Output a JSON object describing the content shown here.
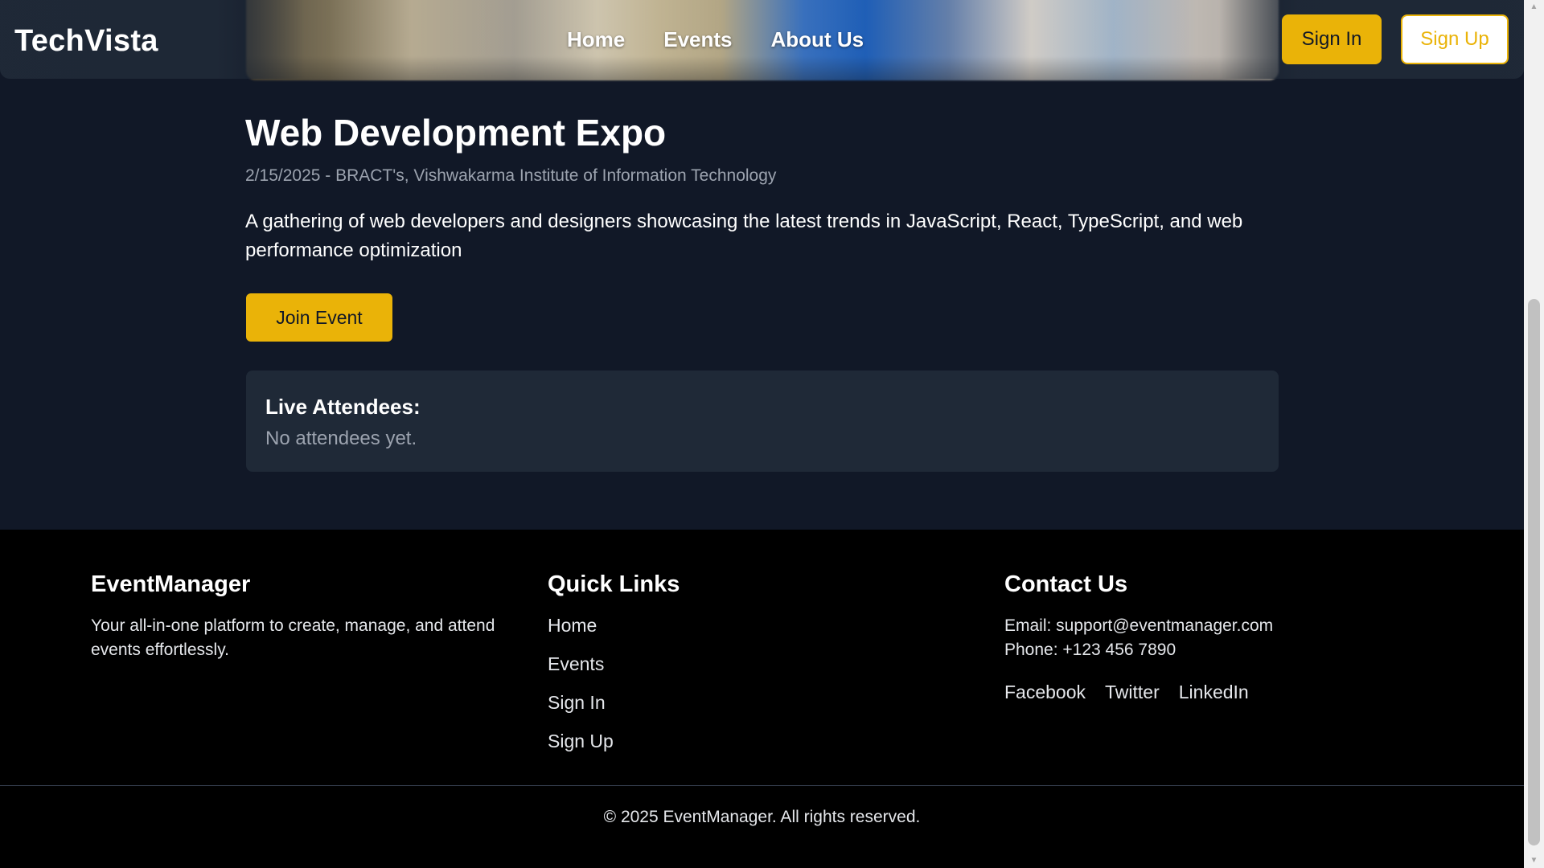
{
  "header": {
    "logo": "TechVista",
    "nav": [
      "Home",
      "Events",
      "About Us"
    ],
    "sign_in": "Sign In",
    "sign_up": "Sign Up"
  },
  "event": {
    "title": "Web Development Expo",
    "meta": "2/15/2025 - BRACT's, Vishwakarma Institute of Information Technology",
    "description": "A gathering of web developers and designers showcasing the latest trends in JavaScript, React, TypeScript, and web performance optimization",
    "join_label": "Join Event",
    "attendees_title": "Live Attendees:",
    "attendees_empty": "No attendees yet."
  },
  "footer": {
    "about_title": "EventManager",
    "about_text": "Your all-in-one platform to create, manage, and attend events effortlessly.",
    "links_title": "Quick Links",
    "links": [
      "Home",
      "Events",
      "Sign In",
      "Sign Up"
    ],
    "contact_title": "Contact Us",
    "email": "Email: support@eventmanager.com",
    "phone": "Phone: +123 456 7890",
    "social": [
      "Facebook",
      "Twitter",
      "LinkedIn"
    ],
    "copyright": "© 2025 EventManager. All rights reserved."
  },
  "colors": {
    "accent": "#eab308",
    "page_bg": "#111827",
    "card_bg": "#1f2937",
    "footer_bg": "#000000",
    "muted_text": "#9ca3af"
  },
  "scrollbar": {
    "up_icon": "triangle-up-icon",
    "down_icon": "triangle-down-icon"
  }
}
